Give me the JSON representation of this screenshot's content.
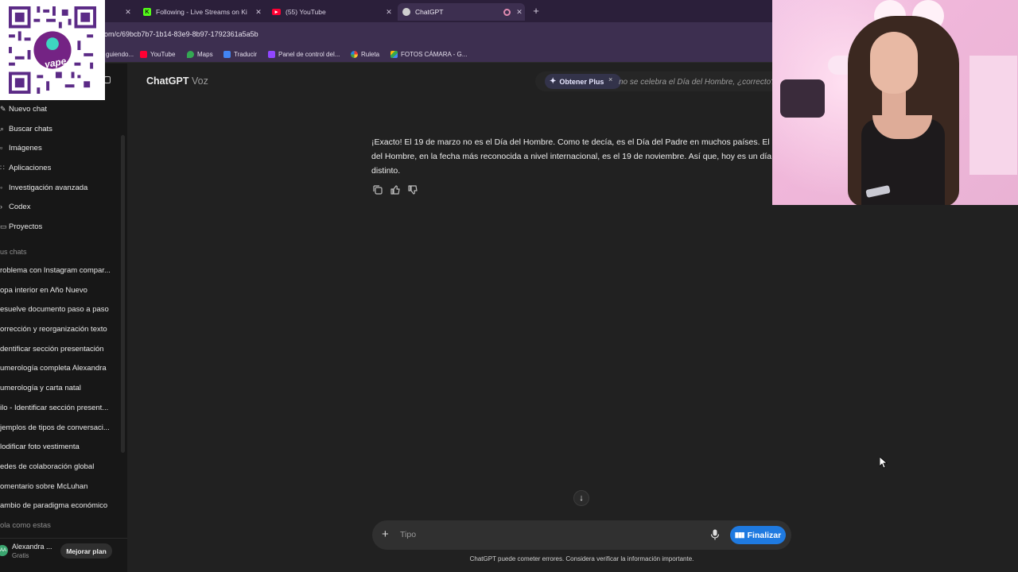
{
  "browser": {
    "tabs": [
      {
        "label": "",
        "active": false
      },
      {
        "label": "Following - Live Streams on Ki",
        "active": false
      },
      {
        "label": "(55) YouTube",
        "active": false
      },
      {
        "label": "ChatGPT",
        "active": true
      }
    ],
    "new_tab": "+",
    "url": "om/c/69bcb7b7-1b14-83e9-8b97-1792361a5a5b",
    "bookmarks": [
      {
        "label": "guiendo..."
      },
      {
        "label": "YouTube"
      },
      {
        "label": "Maps"
      },
      {
        "label": "Traducir"
      },
      {
        "label": "Panel de control del..."
      },
      {
        "label": "Ruleta"
      },
      {
        "label": "FOTOS CÁMARA - G..."
      }
    ]
  },
  "overlay": {
    "qr_brand": "yape"
  },
  "sidebar": {
    "nav": [
      {
        "label": "Nuevo chat",
        "icon": "edit-icon"
      },
      {
        "label": "Buscar chats",
        "icon": "search-icon"
      },
      {
        "label": "Imágenes",
        "icon": "image-icon"
      },
      {
        "label": "Aplicaciones",
        "icon": "apps-icon"
      },
      {
        "label": "Investigación avanzada",
        "icon": "research-icon"
      },
      {
        "label": "Codex",
        "icon": "code-icon"
      },
      {
        "label": "Proyectos",
        "icon": "folder-icon"
      }
    ],
    "section_label": "us chats",
    "chats": [
      "roblema con Instagram compar...",
      "opa interior en Año Nuevo",
      "esuelve documento paso a paso",
      "orrección y reorganización texto",
      "dentificar sección presentación",
      "umerología completa Alexandra",
      "umerología y carta natal",
      "ilo - Identificar sección present...",
      "jemplos de tipos de conversaci...",
      "lodificar foto vestimenta",
      "edes de colaboración global",
      "omentario sobre McLuhan",
      "ambio de paradigma económico",
      "ola como estas"
    ],
    "user": {
      "initials": "AA",
      "name": "Alexandra ...",
      "plan": "Gratis",
      "upgrade_label": "Mejorar plan"
    }
  },
  "main": {
    "brand": "ChatGPT",
    "brand_mode": "Voz",
    "plus_label": "Obtener Plus",
    "plus_close": "×",
    "peek_text": "no se celebra el Día del Hombre, ¿correcto?",
    "answer_lines": [
      "¡Exacto! El 19 de marzo no es el Día del Hombre. Como te decía, es el Día del Padre en muchos países. El Día Internacional",
      "del Hombre, en la fecha más reconocida a nivel internacional, es el 19 de noviembre. Así que, hoy es un día",
      "distinto."
    ],
    "composer_placeholder": "Tipo",
    "finish_label": "Finalizar",
    "disclaimer": "ChatGPT puede cometer errores. Considera verificar la información importante."
  }
}
